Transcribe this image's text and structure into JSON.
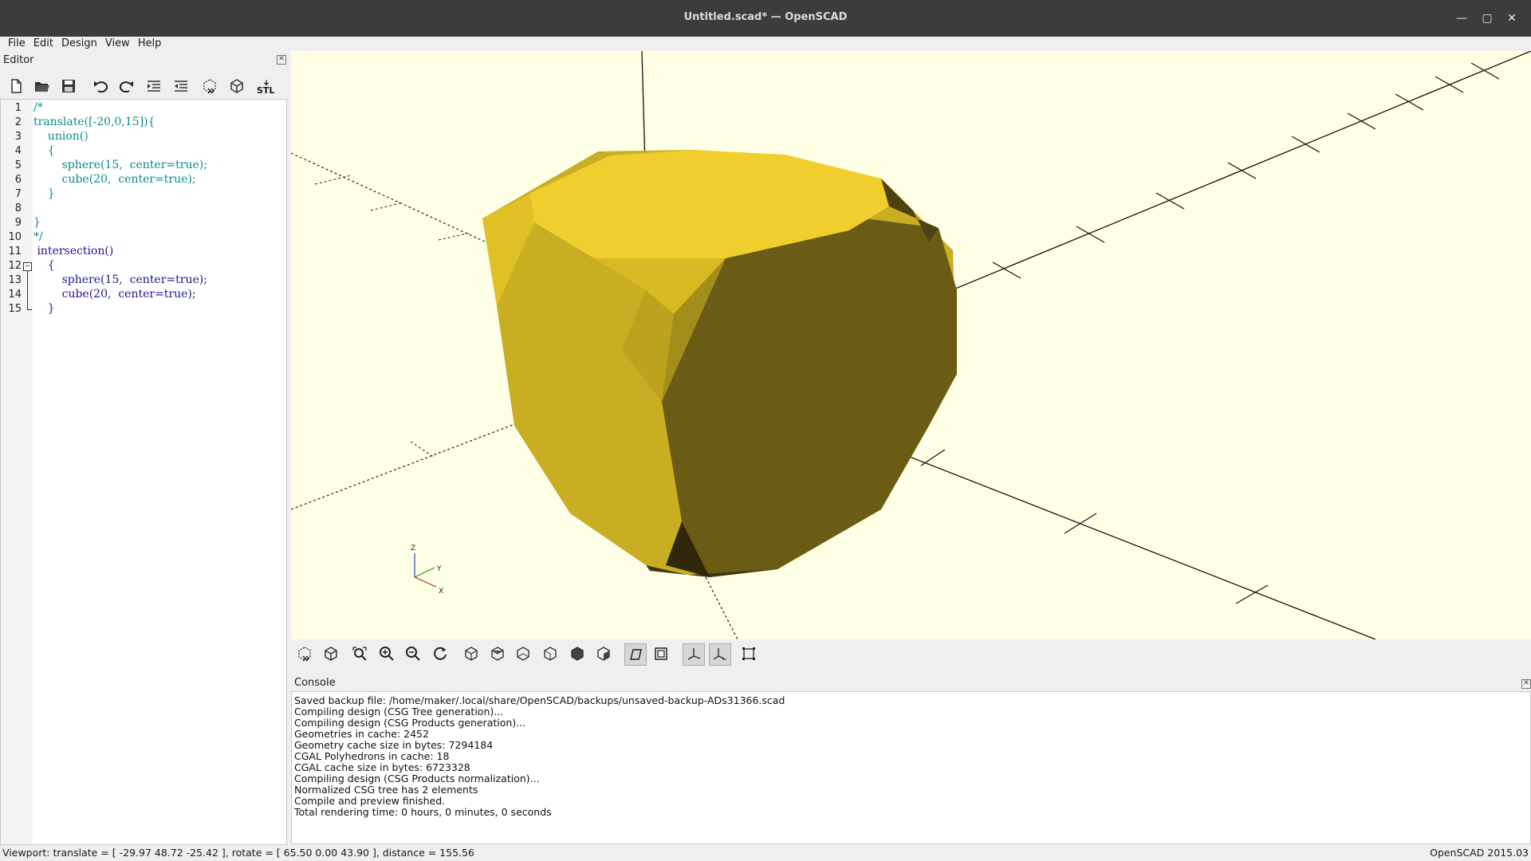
{
  "window": {
    "title": "Untitled.scad* — OpenSCAD"
  },
  "menu": {
    "items": [
      "File",
      "Edit",
      "Design",
      "View",
      "Help"
    ]
  },
  "editor": {
    "title": "Editor",
    "toolbar_stl_label": "STL",
    "lines": [
      {
        "n": "1",
        "text": "/*"
      },
      {
        "n": "2",
        "text": "translate([-20,0,15]){"
      },
      {
        "n": "3",
        "text": "    union()"
      },
      {
        "n": "4",
        "text": "    {"
      },
      {
        "n": "5",
        "text": "        sphere(15,  center=true);"
      },
      {
        "n": "6",
        "text": "        cube(20,  center=true);"
      },
      {
        "n": "7",
        "text": "    }"
      },
      {
        "n": "8",
        "text": ""
      },
      {
        "n": "9",
        "text": "}"
      },
      {
        "n": "10",
        "text": "*/"
      },
      {
        "n": "11",
        "text": " intersection()"
      },
      {
        "n": "12",
        "text": "    {"
      },
      {
        "n": "13",
        "text": "        sphere(15,  center=true);"
      },
      {
        "n": "14",
        "text": "        cube(20,  center=true);"
      },
      {
        "n": "15",
        "text": "    }"
      }
    ]
  },
  "viewport": {
    "axes_labels": {
      "z": "Z",
      "y": "Y",
      "x": "X"
    },
    "model_color": "#e8c520"
  },
  "console": {
    "title": "Console",
    "lines": [
      "Saved backup file: /home/maker/.local/share/OpenSCAD/backups/unsaved-backup-ADs31366.scad",
      "Compiling design (CSG Tree generation)...",
      "Compiling design (CSG Products generation)...",
      "Geometries in cache: 2452",
      "Geometry cache size in bytes: 7294184",
      "CGAL Polyhedrons in cache: 18",
      "CGAL cache size in bytes: 6723328",
      "Compiling design (CSG Products normalization)...",
      "Normalized CSG tree has 2 elements",
      "Compile and preview finished.",
      "Total rendering time: 0 hours, 0 minutes, 0 seconds"
    ]
  },
  "status": {
    "viewport_info": "Viewport: translate = [ -29.97 48.72 -25.42 ], rotate = [ 65.50 0.00 43.90 ], distance = 155.56",
    "version": "OpenSCAD 2015.03"
  }
}
